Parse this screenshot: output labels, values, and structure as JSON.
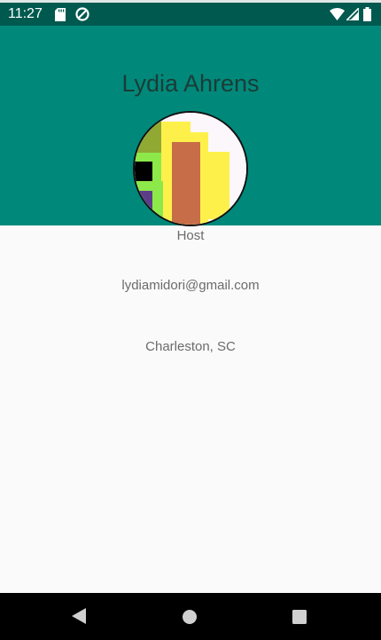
{
  "status_bar": {
    "time": "11:27",
    "icons": [
      "sd-card-icon",
      "sync-icon",
      "wifi-icon",
      "cellular-icon",
      "battery-icon"
    ]
  },
  "profile": {
    "name": "Lydia Ahrens",
    "role": "Host",
    "email": "lydiamidori@gmail.com",
    "location": "Charleston, SC"
  },
  "navigation": {
    "icons": [
      "back-icon",
      "home-icon",
      "recents-icon"
    ]
  },
  "colors": {
    "status_bar": "#00594f",
    "header": "#00897b",
    "background": "#fafafa",
    "nav_bar": "#000000"
  }
}
